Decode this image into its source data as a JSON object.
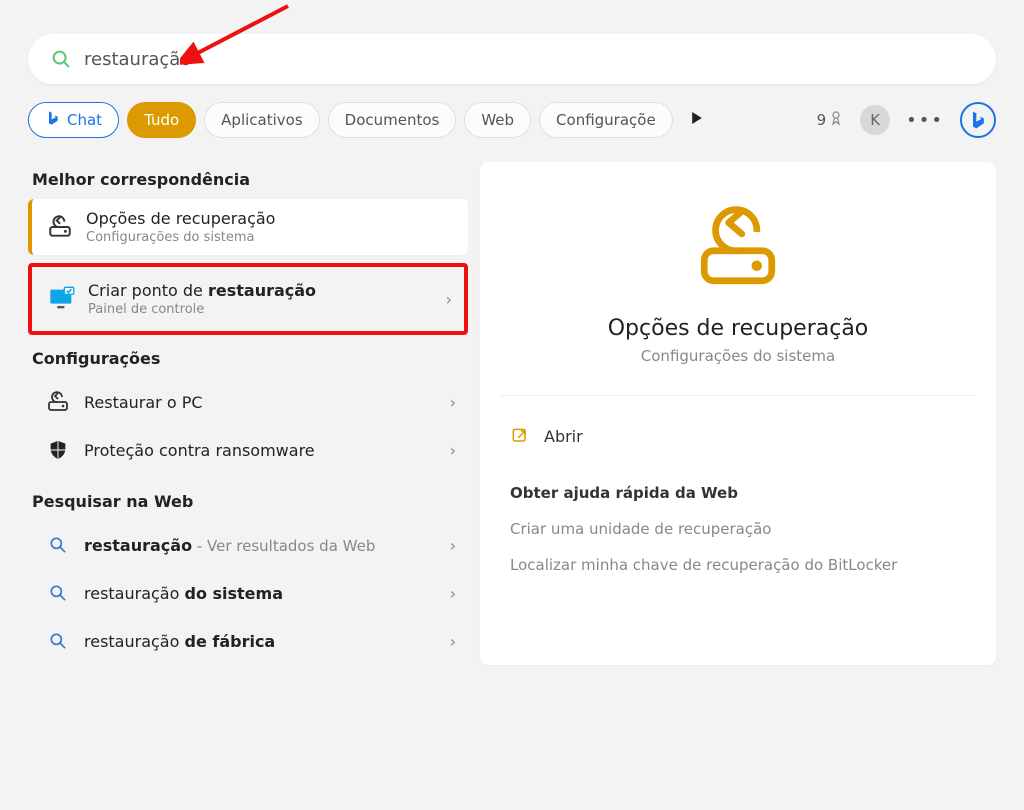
{
  "search": {
    "value": "restauração"
  },
  "pills": {
    "chat": "Chat",
    "all": "Tudo",
    "apps": "Aplicativos",
    "docs": "Documentos",
    "web": "Web",
    "settings": "Configuraçõe"
  },
  "header": {
    "points": "9",
    "avatar_initial": "K"
  },
  "left": {
    "best_heading": "Melhor correspondência",
    "best": {
      "title": "Opções de recuperação",
      "subtitle": "Configurações do sistema"
    },
    "highlighted": {
      "title_prefix": "Criar ponto de ",
      "title_bold": "restauração",
      "subtitle": "Painel de controle"
    },
    "settings_heading": "Configurações",
    "settings": [
      {
        "title": "Restaurar o PC"
      },
      {
        "title": "Proteção contra ransomware"
      }
    ],
    "web_heading": "Pesquisar na Web",
    "web": [
      {
        "bold": "restauração",
        "suffix": " - Ver resultados da Web"
      },
      {
        "prefix": "restauração ",
        "bold": "do sistema"
      },
      {
        "prefix": "restauração ",
        "bold": "de fábrica"
      }
    ]
  },
  "right": {
    "title": "Opções de recuperação",
    "subtitle": "Configurações do sistema",
    "open_label": "Abrir",
    "help_heading": "Obter ajuda rápida da Web",
    "help_links": [
      "Criar uma unidade de recuperação",
      "Localizar minha chave de recuperação do BitLocker"
    ]
  }
}
